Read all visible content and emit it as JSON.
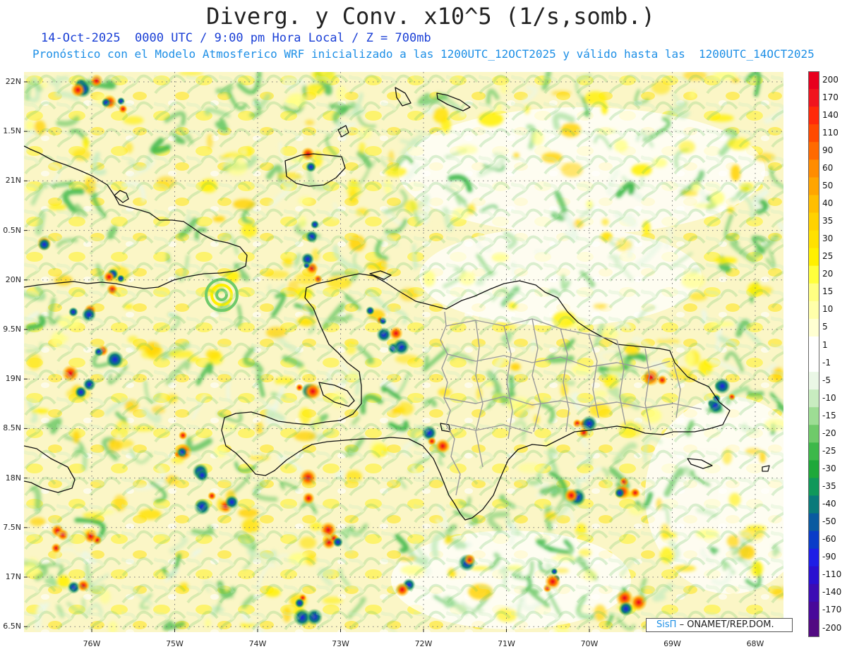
{
  "header": {
    "title": "Diverg. y Conv. x10^5 (1/s,somb.)",
    "line1": "14-Oct-2025  0000 UTC / 9:00 pm Hora Local / Z = 700mb",
    "line2": "Pronóstico con el Modelo Atmosferico WRF inicializado a las 1200UTC_12OCT2025 y válido hasta las  1200UTC_14OCT2025"
  },
  "map": {
    "lat_labels": [
      "22N",
      "1.5N",
      "21N",
      "0.5N",
      "20N",
      "9.5N",
      "19N",
      "8.5N",
      "18N",
      "7.5N",
      "17N",
      "6.5N"
    ],
    "lon_labels": [
      "76W",
      "75W",
      "74W",
      "73W",
      "72W",
      "71W",
      "70W",
      "69W",
      "68W"
    ],
    "colors": {
      "land_outline": "#111111",
      "province_lines": "#9a9a9a",
      "grid_lines": "#777777"
    }
  },
  "colorbar": {
    "labels": [
      "200",
      "170",
      "140",
      "110",
      "90",
      "60",
      "50",
      "40",
      "35",
      "30",
      "25",
      "20",
      "15",
      "10",
      "5",
      "1",
      "-1",
      "-5",
      "-10",
      "-15",
      "-20",
      "-25",
      "-30",
      "-35",
      "-40",
      "-50",
      "-60",
      "-90",
      "-110",
      "-140",
      "-170",
      "-200"
    ],
    "colors": [
      "#e8001e",
      "#f0141e",
      "#ff2a0a",
      "#ff4a00",
      "#ff6a00",
      "#ff8c00",
      "#ffa500",
      "#ffbe00",
      "#ffd200",
      "#ffe100",
      "#fff000",
      "#ffff3c",
      "#ffff82",
      "#ffffaa",
      "#ffffd2",
      "#ffffff",
      "#ffffff",
      "#eaf7e6",
      "#c8ecc0",
      "#9ddd94",
      "#6fca6a",
      "#3db84a",
      "#1ea83a",
      "#10985a",
      "#0a7a7a",
      "#0a5aa0",
      "#0a3cc8",
      "#1e1ee6",
      "#2a10d0",
      "#3c0cb4",
      "#48089a",
      "#520a82"
    ]
  },
  "credit": {
    "brand": "SisΠ",
    "text": "– ONAMET/REP.DOM."
  }
}
